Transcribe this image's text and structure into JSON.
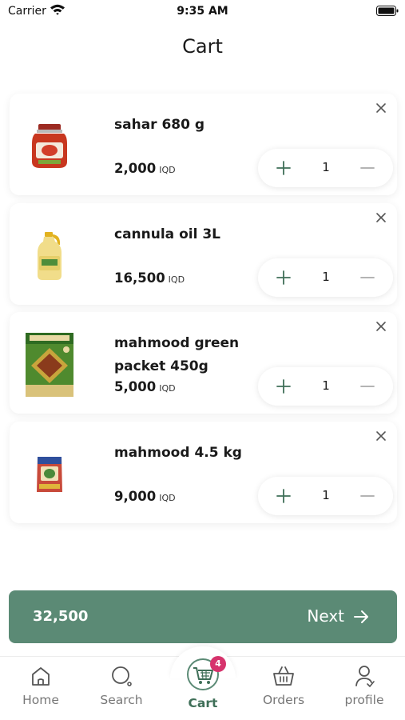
{
  "status_bar": {
    "carrier": "Carrier",
    "time": "9:35 AM"
  },
  "header": {
    "title": "Cart"
  },
  "cart": {
    "currency": "IQD",
    "items": [
      {
        "name": "sahar 680 g",
        "price": "2,000",
        "quantity": "1",
        "image": "jam-jar"
      },
      {
        "name": "cannula oil 3L",
        "price": "16,500",
        "quantity": "1",
        "image": "oil-bottle"
      },
      {
        "name": "mahmood green packet 450g",
        "price": "5,000",
        "quantity": "1",
        "image": "tea-packet"
      },
      {
        "name": "mahmood 4.5 kg",
        "price": "9,000",
        "quantity": "1",
        "image": "rice-bag"
      }
    ]
  },
  "checkout": {
    "total": "32,500",
    "next_label": "Next"
  },
  "tabs": [
    {
      "label": "Home",
      "icon": "home-icon"
    },
    {
      "label": "Search",
      "icon": "search-icon"
    },
    {
      "label": "Cart",
      "icon": "cart-icon",
      "badge": "4",
      "active": true
    },
    {
      "label": "Orders",
      "icon": "basket-icon"
    },
    {
      "label": "profile",
      "icon": "profile-icon"
    }
  ],
  "colors": {
    "accent": "#5b8a75",
    "accent_dark": "#3f6f58",
    "badge": "#d6336c",
    "inactive": "#777777"
  }
}
